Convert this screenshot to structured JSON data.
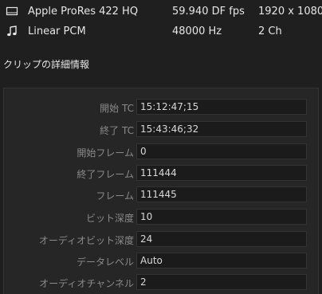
{
  "media": [
    {
      "icon": "film-icon",
      "codec": "Apple ProRes 422 HQ",
      "rate": "59.940 DF fps",
      "resolution": "1920 x 1080"
    },
    {
      "icon": "music-note-icon",
      "codec": "Linear PCM",
      "rate": "48000 Hz",
      "resolution": "2 Ch"
    }
  ],
  "details": {
    "title": "クリップの詳細情報",
    "fields": [
      {
        "label": "開始 TC",
        "value": "15:12:47;15"
      },
      {
        "label": "終了 TC",
        "value": "15:43:46;32"
      },
      {
        "label": "開始フレーム",
        "value": "0"
      },
      {
        "label": "終了フレーム",
        "value": "111444"
      },
      {
        "label": "フレーム",
        "value": "111445"
      },
      {
        "label": "ビット深度",
        "value": "10"
      },
      {
        "label": "オーディオビット深度",
        "value": "24"
      },
      {
        "label": "データレベル",
        "value": "Auto"
      },
      {
        "label": "オーディオチャンネル",
        "value": "2"
      }
    ]
  }
}
